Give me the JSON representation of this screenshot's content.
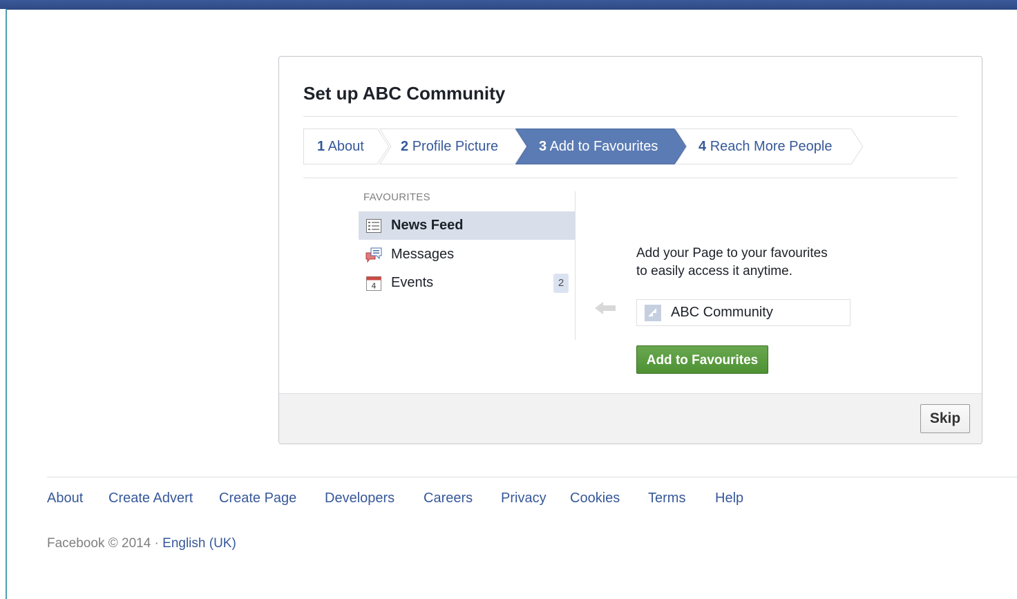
{
  "dialog": {
    "title": "Set up ABC Community",
    "steps": [
      {
        "num": "1",
        "label": "About",
        "active": false
      },
      {
        "num": "2",
        "label": "Profile Picture",
        "active": false
      },
      {
        "num": "3",
        "label": "Add to Favourites",
        "active": true
      },
      {
        "num": "4",
        "label": "Reach More People",
        "active": false
      }
    ],
    "favourites": {
      "header": "FAVOURITES",
      "items": [
        {
          "label": "News Feed",
          "icon": "news-feed-icon",
          "selected": true
        },
        {
          "label": "Messages",
          "icon": "messages-icon",
          "selected": false
        },
        {
          "label": "Events",
          "icon": "calendar-icon",
          "selected": false,
          "count": "2",
          "icon_text": "4"
        }
      ]
    },
    "description_line1": "Add your Page to your favourites",
    "description_line2": "to easily access it anytime.",
    "page_name": "ABC Community",
    "add_button": "Add to Favourites",
    "skip_button": "Skip"
  },
  "footer": {
    "links": [
      "About",
      "Create Advert",
      "Create Page",
      "Developers",
      "Careers",
      "Privacy",
      "Cookies",
      "Terms",
      "Help"
    ],
    "copyright": "Facebook © 2014 ·",
    "language": "English (UK)"
  },
  "colors": {
    "brand_blue": "#3b5998",
    "active_step": "#5b7bb4",
    "link": "#365899",
    "green_button": "#5aa03f"
  }
}
